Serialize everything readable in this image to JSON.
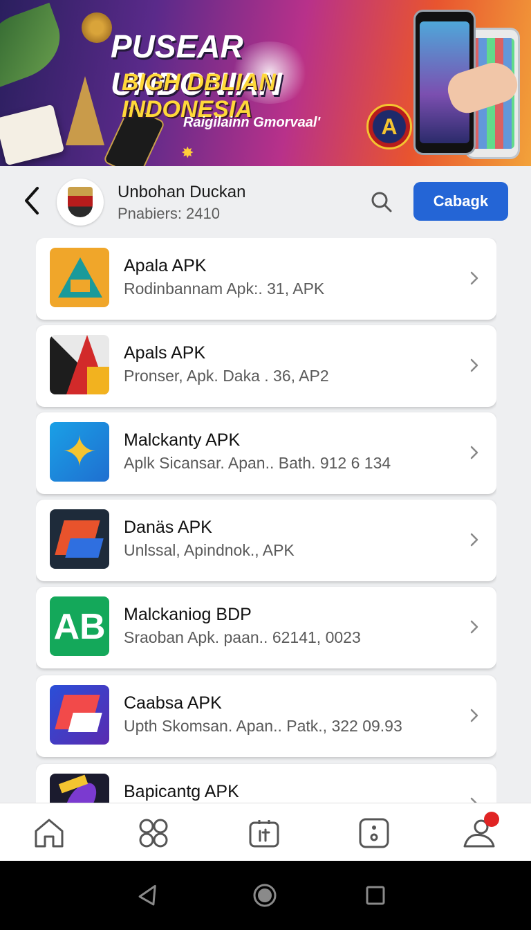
{
  "banner": {
    "title_line1": "PUSEAR UNDONIAN",
    "title_line2": "BIGH DBLIAN INDONESIA",
    "tagline": "Raigilainn Gmorvaal'",
    "coin_letter": "A"
  },
  "header": {
    "title": "Unbohan Duckan",
    "subtitle": "Pnabiers: 2410",
    "action_label": "Cabagk"
  },
  "apps": [
    {
      "name": "Apala APK",
      "desc": "Rodinbannam Apk:. 31, APK",
      "icon": "teal-a-icon"
    },
    {
      "name": "Apals APK",
      "desc": "Pronser, Apk. Daka . 36, AP2",
      "icon": "red-black-a-icon"
    },
    {
      "name": "Malckanty APK",
      "desc": "Aplk Sicansar. Apan.. Bath. 912 6 134",
      "icon": "star-arrow-icon"
    },
    {
      "name": "Danäs APK",
      "desc": "Unlssal, Apindnok., APK",
      "icon": "orange-blue-chevron-icon"
    },
    {
      "name": "Malckaniog BDP",
      "desc": "Sraoban Apk. paan.. 62141, 0023",
      "icon": "ab-monogram-icon"
    },
    {
      "name": "Caabsa APK",
      "desc": "Upth Skomsan. Apan.. Patk., 322 09.93",
      "icon": "red-white-chevron-icon"
    },
    {
      "name": "Bapicantg APK",
      "desc": "",
      "icon": "purple-feather-icon"
    }
  ],
  "bottom_nav": [
    "home-icon",
    "apps-grid-icon",
    "store-icon",
    "info-icon",
    "profile-icon"
  ],
  "colors": {
    "accent": "#2465d6",
    "badge": "#e02424",
    "background": "#eeeff1"
  }
}
